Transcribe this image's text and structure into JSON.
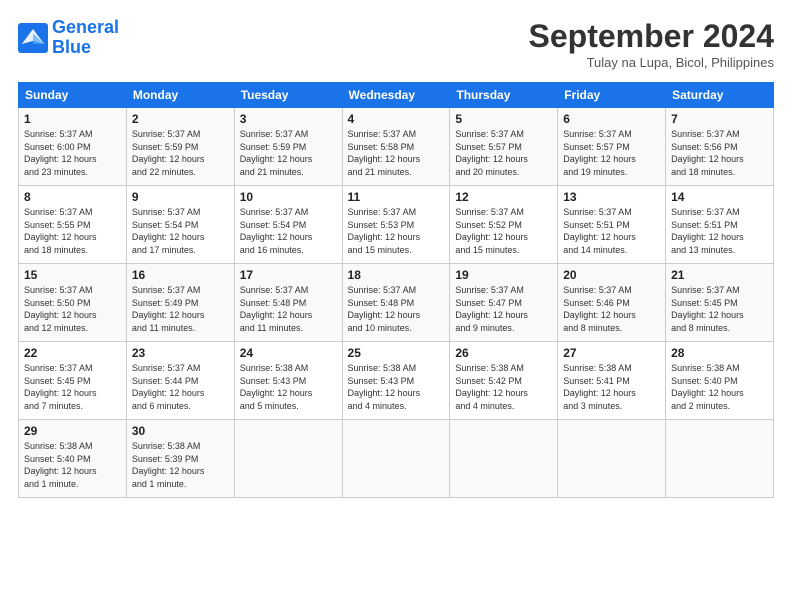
{
  "header": {
    "logo_line1": "General",
    "logo_line2": "Blue",
    "month": "September 2024",
    "location": "Tulay na Lupa, Bicol, Philippines"
  },
  "days_of_week": [
    "Sunday",
    "Monday",
    "Tuesday",
    "Wednesday",
    "Thursday",
    "Friday",
    "Saturday"
  ],
  "weeks": [
    [
      {
        "day": "1",
        "info": "Sunrise: 5:37 AM\nSunset: 6:00 PM\nDaylight: 12 hours\nand 23 minutes."
      },
      {
        "day": "2",
        "info": "Sunrise: 5:37 AM\nSunset: 5:59 PM\nDaylight: 12 hours\nand 22 minutes."
      },
      {
        "day": "3",
        "info": "Sunrise: 5:37 AM\nSunset: 5:59 PM\nDaylight: 12 hours\nand 21 minutes."
      },
      {
        "day": "4",
        "info": "Sunrise: 5:37 AM\nSunset: 5:58 PM\nDaylight: 12 hours\nand 21 minutes."
      },
      {
        "day": "5",
        "info": "Sunrise: 5:37 AM\nSunset: 5:57 PM\nDaylight: 12 hours\nand 20 minutes."
      },
      {
        "day": "6",
        "info": "Sunrise: 5:37 AM\nSunset: 5:57 PM\nDaylight: 12 hours\nand 19 minutes."
      },
      {
        "day": "7",
        "info": "Sunrise: 5:37 AM\nSunset: 5:56 PM\nDaylight: 12 hours\nand 18 minutes."
      }
    ],
    [
      {
        "day": "8",
        "info": "Sunrise: 5:37 AM\nSunset: 5:55 PM\nDaylight: 12 hours\nand 18 minutes."
      },
      {
        "day": "9",
        "info": "Sunrise: 5:37 AM\nSunset: 5:54 PM\nDaylight: 12 hours\nand 17 minutes."
      },
      {
        "day": "10",
        "info": "Sunrise: 5:37 AM\nSunset: 5:54 PM\nDaylight: 12 hours\nand 16 minutes."
      },
      {
        "day": "11",
        "info": "Sunrise: 5:37 AM\nSunset: 5:53 PM\nDaylight: 12 hours\nand 15 minutes."
      },
      {
        "day": "12",
        "info": "Sunrise: 5:37 AM\nSunset: 5:52 PM\nDaylight: 12 hours\nand 15 minutes."
      },
      {
        "day": "13",
        "info": "Sunrise: 5:37 AM\nSunset: 5:51 PM\nDaylight: 12 hours\nand 14 minutes."
      },
      {
        "day": "14",
        "info": "Sunrise: 5:37 AM\nSunset: 5:51 PM\nDaylight: 12 hours\nand 13 minutes."
      }
    ],
    [
      {
        "day": "15",
        "info": "Sunrise: 5:37 AM\nSunset: 5:50 PM\nDaylight: 12 hours\nand 12 minutes."
      },
      {
        "day": "16",
        "info": "Sunrise: 5:37 AM\nSunset: 5:49 PM\nDaylight: 12 hours\nand 11 minutes."
      },
      {
        "day": "17",
        "info": "Sunrise: 5:37 AM\nSunset: 5:48 PM\nDaylight: 12 hours\nand 11 minutes."
      },
      {
        "day": "18",
        "info": "Sunrise: 5:37 AM\nSunset: 5:48 PM\nDaylight: 12 hours\nand 10 minutes."
      },
      {
        "day": "19",
        "info": "Sunrise: 5:37 AM\nSunset: 5:47 PM\nDaylight: 12 hours\nand 9 minutes."
      },
      {
        "day": "20",
        "info": "Sunrise: 5:37 AM\nSunset: 5:46 PM\nDaylight: 12 hours\nand 8 minutes."
      },
      {
        "day": "21",
        "info": "Sunrise: 5:37 AM\nSunset: 5:45 PM\nDaylight: 12 hours\nand 8 minutes."
      }
    ],
    [
      {
        "day": "22",
        "info": "Sunrise: 5:37 AM\nSunset: 5:45 PM\nDaylight: 12 hours\nand 7 minutes."
      },
      {
        "day": "23",
        "info": "Sunrise: 5:37 AM\nSunset: 5:44 PM\nDaylight: 12 hours\nand 6 minutes."
      },
      {
        "day": "24",
        "info": "Sunrise: 5:38 AM\nSunset: 5:43 PM\nDaylight: 12 hours\nand 5 minutes."
      },
      {
        "day": "25",
        "info": "Sunrise: 5:38 AM\nSunset: 5:43 PM\nDaylight: 12 hours\nand 4 minutes."
      },
      {
        "day": "26",
        "info": "Sunrise: 5:38 AM\nSunset: 5:42 PM\nDaylight: 12 hours\nand 4 minutes."
      },
      {
        "day": "27",
        "info": "Sunrise: 5:38 AM\nSunset: 5:41 PM\nDaylight: 12 hours\nand 3 minutes."
      },
      {
        "day": "28",
        "info": "Sunrise: 5:38 AM\nSunset: 5:40 PM\nDaylight: 12 hours\nand 2 minutes."
      }
    ],
    [
      {
        "day": "29",
        "info": "Sunrise: 5:38 AM\nSunset: 5:40 PM\nDaylight: 12 hours\nand 1 minute."
      },
      {
        "day": "30",
        "info": "Sunrise: 5:38 AM\nSunset: 5:39 PM\nDaylight: 12 hours\nand 1 minute."
      },
      {
        "day": "",
        "info": ""
      },
      {
        "day": "",
        "info": ""
      },
      {
        "day": "",
        "info": ""
      },
      {
        "day": "",
        "info": ""
      },
      {
        "day": "",
        "info": ""
      }
    ]
  ]
}
